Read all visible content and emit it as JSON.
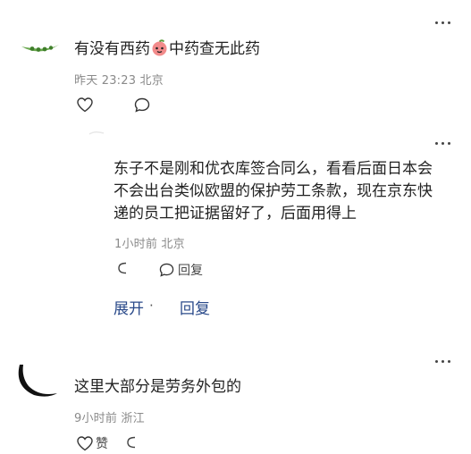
{
  "comments": [
    {
      "text_pre": "有没有西药",
      "emoji": "peach-face-emoji",
      "text_post": "中药查无此药",
      "meta": "昨天 23:23 北京"
    },
    {
      "text": "东子不是刚和优衣库签合同么，看看后面日本会不会出台类似欧盟的保护劳工条款，现在京东快递的员工把证据留好了，后面用得上",
      "meta": "1小时前 北京",
      "reply_label": "回复",
      "expand_label": "展开",
      "separator": "·",
      "reply_link_label": "回复"
    },
    {
      "text": "这里大部分是劳务外包的",
      "meta": "9小时前 浙江",
      "like_label": "赞"
    }
  ],
  "icons": {
    "like": "heart-icon",
    "comment": "comment-bubble-icon",
    "reply_arrow": "reply-arrow-icon",
    "more": "more-dots-icon"
  }
}
